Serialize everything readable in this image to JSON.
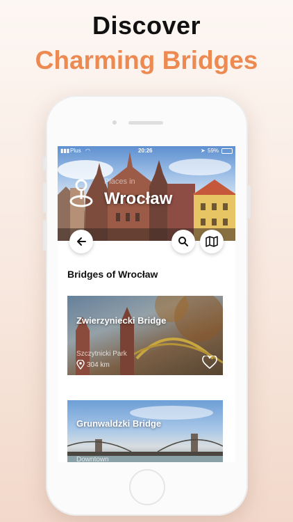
{
  "headline": {
    "line1": "Discover",
    "line2": "Charming Bridges"
  },
  "colors": {
    "accent": "#ec8a52",
    "text": "#111111"
  },
  "status_bar": {
    "carrier": "Plus",
    "time": "20:26",
    "battery": "59%"
  },
  "hero": {
    "kicker": "Places in",
    "city": "Wrocław"
  },
  "section": {
    "title": "Bridges of Wrocław"
  },
  "cards": [
    {
      "title": "Zwierzyniecki Bridge",
      "area": "Szczytnicki Park",
      "distance": "304 km",
      "favorite_icon": "heart-outline-icon"
    },
    {
      "title": "Grunwaldzki Bridge",
      "area": "Downtown",
      "favorite_icon": "heart-outline-icon"
    }
  ],
  "icons": {
    "back": "arrow-left-icon",
    "search": "search-icon",
    "map": "map-icon",
    "location": "location-pin-icon"
  }
}
